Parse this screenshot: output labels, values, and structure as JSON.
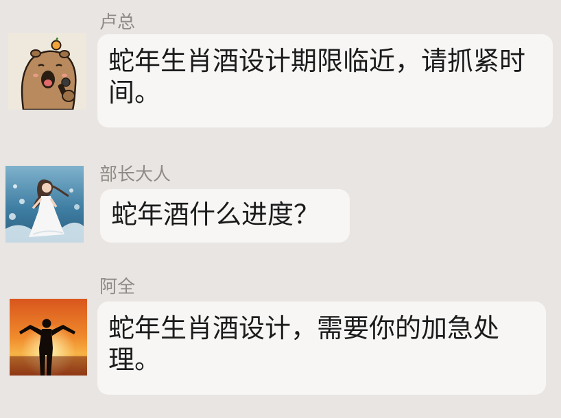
{
  "messages": [
    {
      "sender": "卢总",
      "avatar": "capybara-avatar",
      "text": "蛇年生肖酒设计期限临近，请抓紧时间。"
    },
    {
      "sender": "部长大人",
      "avatar": "girl-seaside-avatar",
      "text": "蛇年酒什么进度？"
    },
    {
      "sender": "阿全",
      "avatar": "sunset-silhouette-avatar",
      "text": "蛇年生肖酒设计，需要你的加急处理。"
    }
  ],
  "colors": {
    "background": "#e9e5e2",
    "bubble": "#f7f6f5",
    "sender_name": "#8f8a87",
    "message_text": "#1b1b1b"
  }
}
